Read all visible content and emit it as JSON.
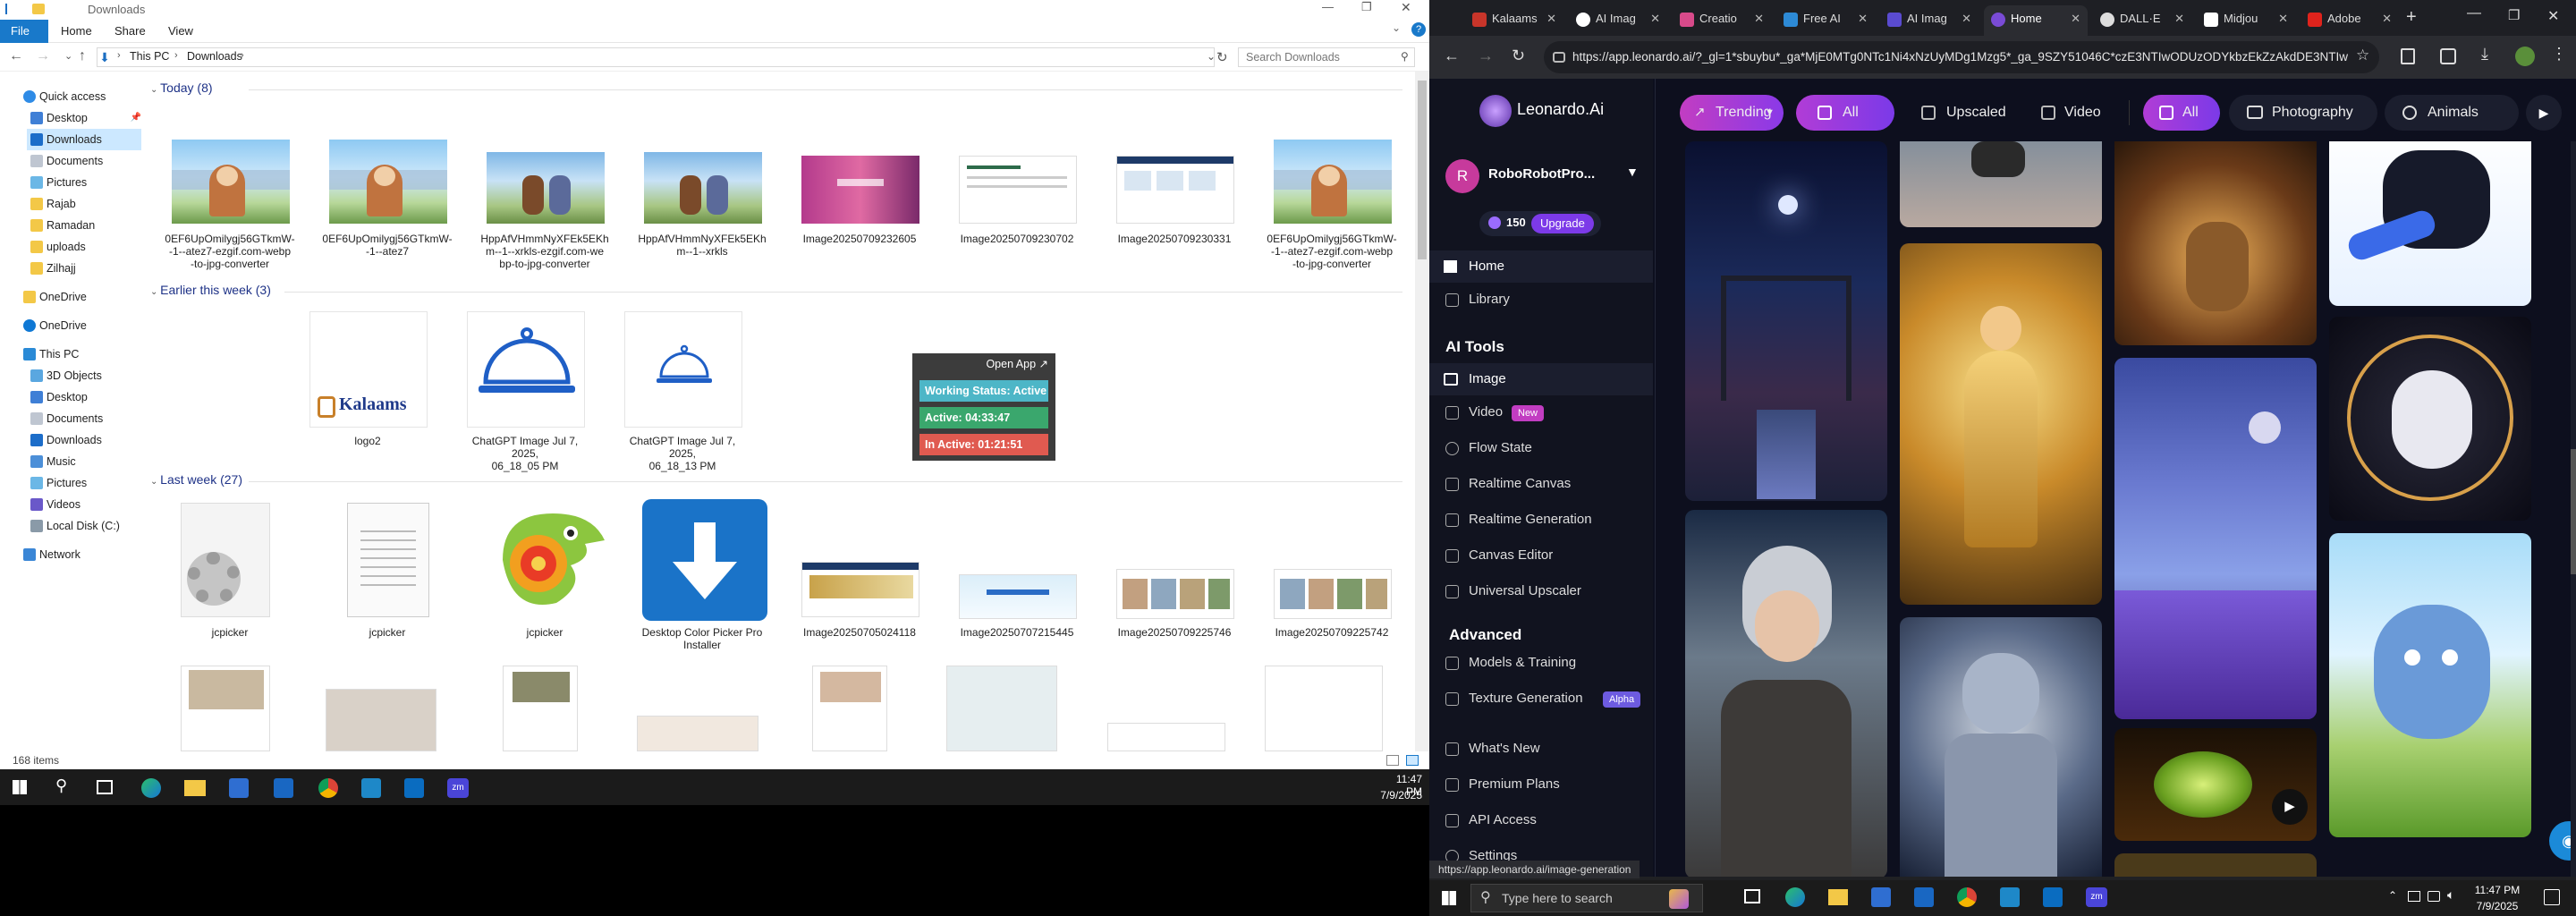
{
  "explorer": {
    "title": "Downloads",
    "ribbon_tabs": [
      "File",
      "Home",
      "Share",
      "View"
    ],
    "path": [
      "This PC",
      "Downloads"
    ],
    "search_placeholder": "Search Downloads",
    "nav": {
      "quick_access": "Quick access",
      "items": [
        "Desktop",
        "Downloads",
        "Documents",
        "Pictures",
        "Rajab",
        "Ramadan",
        "uploads",
        "Zilhajj"
      ],
      "onedrive1": "OneDrive",
      "onedrive2": "OneDrive",
      "this_pc": "This PC",
      "pc_items": [
        "3D Objects",
        "Desktop",
        "Documents",
        "Downloads",
        "Music",
        "Pictures",
        "Videos",
        "Local Disk (C:)"
      ],
      "network": "Network"
    },
    "groups": {
      "today": "Today (8)",
      "week": "Earlier this week (3)",
      "last": "Last week (27)"
    },
    "today_files": [
      "0EF6UpOmilygj56GTkmW-\n-1--atez7-ezgif.com-webp\n-to-jpg-converter",
      "0EF6UpOmilygj56GTkmW-\n-1--atez7",
      "HppAfVHmmNyXFEk5EKh\nm--1--xrkls-ezgif.com-we\nbp-to-jpg-converter",
      "HppAfVHmmNyXFEk5EKh\nm--1--xrkls",
      "Image20250709232605",
      "Image20250709230702",
      "Image20250709230331",
      "0EF6UpOmilygj56GTkmW-\n-1--atez7-ezgif.com-webp\n-to-jpg-converter"
    ],
    "week_files": [
      "logo2",
      "ChatGPT Image Jul 7, 2025,\n06_18_05 PM",
      "ChatGPT Image Jul 7, 2025,\n06_18_13 PM"
    ],
    "last_files": [
      "jcpicker",
      "jcpicker",
      "jcpicker",
      "Desktop Color Picker Pro\nInstaller",
      "Image20250705024118",
      "Image20250707215445",
      "Image20250709225746",
      "Image20250709225742"
    ],
    "logo_text": "Kalaams",
    "status": "168 items"
  },
  "popup": {
    "open_app": "Open App ↗",
    "working": "Working Status: Active",
    "active": "Active: 04:33:47",
    "inactive": "In Active: 01:21:51"
  },
  "taskbar_left": {
    "time": "11:47 PM",
    "date": "7/9/2025"
  },
  "browser": {
    "tabs": [
      "Kalaams",
      "AI Imag",
      "Creatio",
      "Free AI",
      "AI Imag",
      "Home",
      "DALL·E",
      "Midjou",
      "Adobe"
    ],
    "url": "https://app.leonardo.ai/?_gl=1*sbuybu*_ga*MjE0MTg0NTc1Ni4xNzUyMDg1Mzg5*_ga_9SZY51046C*czE3NTIwODUzODYkbzEkZzAkdDE3NTIw",
    "status_url": "https://app.leonardo.ai/image-generation"
  },
  "leonardo": {
    "brand": "Leonardo.Ai",
    "user": "RoboRobotPro...",
    "avatar_letter": "R",
    "tokens": "150",
    "upgrade": "Upgrade",
    "home": "Home",
    "library": "Library",
    "ai_tools": "AI Tools",
    "tools": [
      "Image",
      "Video",
      "Flow State",
      "Realtime Canvas",
      "Realtime Generation",
      "Canvas Editor",
      "Universal Upscaler"
    ],
    "video_badge": "New",
    "advanced": "Advanced",
    "adv_items": [
      "Models & Training",
      "Texture Generation"
    ],
    "alpha": "Alpha",
    "more": [
      "What's New",
      "Premium Plans",
      "API Access",
      "Settings"
    ],
    "pills": [
      "Trending",
      "All",
      "Upscaled",
      "Video",
      "All",
      "Photography",
      "Animals"
    ]
  },
  "taskbar_right": {
    "search": "Type here to search",
    "time": "11:47 PM",
    "date": "7/9/2025"
  }
}
